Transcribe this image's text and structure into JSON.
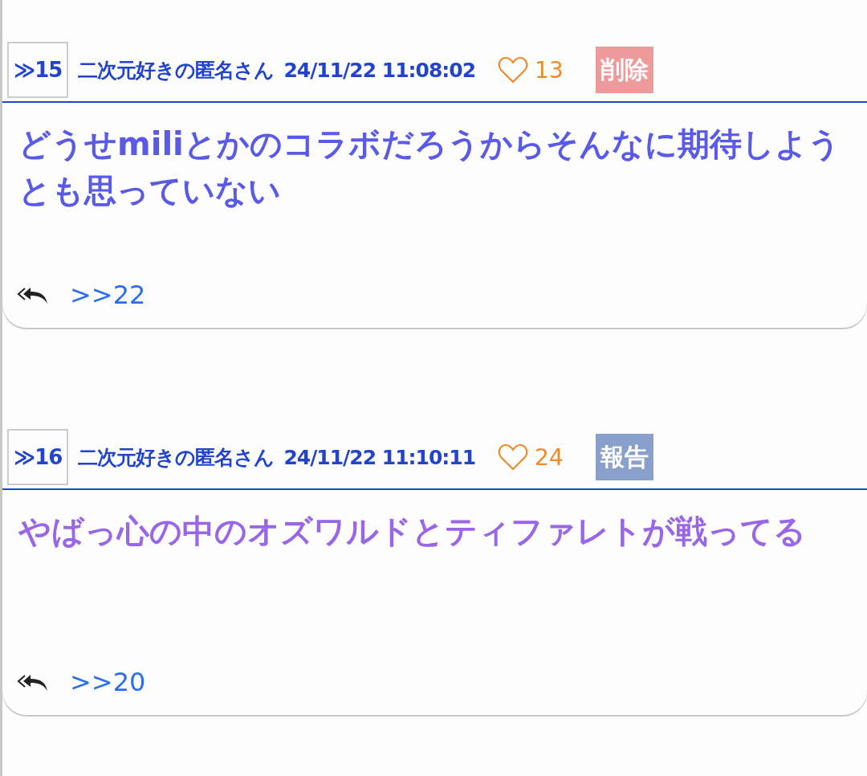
{
  "posts": [
    {
      "number": "≫15",
      "author": "二次元好きの匿名さん",
      "date": "24/11/22 11:08:02",
      "likes": "13",
      "action": {
        "kind": "delete",
        "label": "削除"
      },
      "body": "どうせmiliとかのコラボだろうからそんなに期待しようとも思っていない",
      "color": "#5a5ae8",
      "reply_ref": ">>22"
    },
    {
      "number": "≫16",
      "author": "二次元好きの匿名さん",
      "date": "24/11/22 11:10:11",
      "likes": "24",
      "action": {
        "kind": "report",
        "label": "報告"
      },
      "body": "やばっ心の中のオズワルドとティファレトが戦ってる",
      "color": "#9a66e8",
      "reply_ref": ">>20"
    }
  ]
}
